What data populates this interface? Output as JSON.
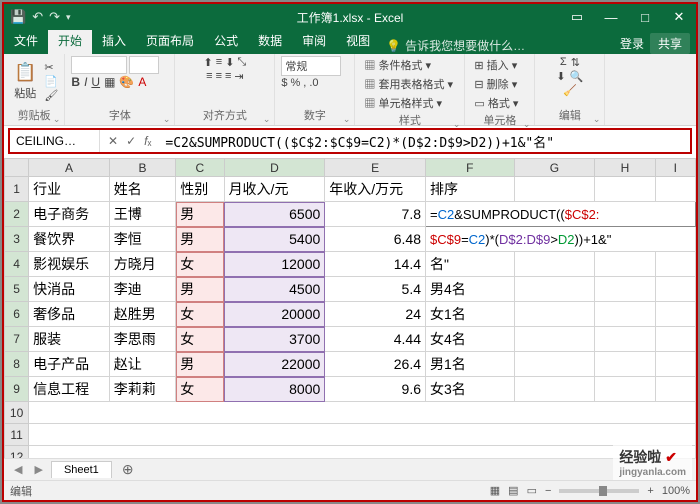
{
  "titlebar": {
    "title": "工作簿1.xlsx - Excel"
  },
  "tabs": {
    "file": "文件",
    "home": "开始",
    "insert": "插入",
    "layout": "页面布局",
    "formulas": "公式",
    "data": "数据",
    "review": "审阅",
    "view": "视图",
    "tell": "告诉我您想要做什么…",
    "login": "登录",
    "share": "共享"
  },
  "ribbon": {
    "clipboard": {
      "paste": "粘贴",
      "label": "剪贴板"
    },
    "font": {
      "label": "字体"
    },
    "align": {
      "wrap": "常规",
      "label": "对齐方式"
    },
    "number": {
      "general": "常规",
      "label": "数字"
    },
    "styles": {
      "cond": "条件格式",
      "table": "套用表格格式",
      "cell": "单元格样式",
      "label": "样式"
    },
    "cells": {
      "insert": "插入",
      "delete": "删除",
      "format": "格式",
      "label": "单元格"
    },
    "editing": {
      "label": "编辑"
    }
  },
  "formula_bar": {
    "name_box": "CEILING…",
    "formula": "=C2&SUMPRODUCT(($C$2:$C$9=C2)*(D$2:D$9>D2))+1&\"名\""
  },
  "columns": [
    "A",
    "B",
    "C",
    "D",
    "E",
    "F",
    "G",
    "H",
    "I"
  ],
  "headers": {
    "A": "行业",
    "B": "姓名",
    "C": "性别",
    "D": "月收入/元",
    "E": "年收入/万元",
    "F": "排序"
  },
  "rows": [
    {
      "A": "电子商务",
      "B": "王博",
      "C": "男",
      "D": "6500",
      "E": "7.8"
    },
    {
      "A": "餐饮界",
      "B": "李恒",
      "C": "男",
      "D": "5400",
      "E": "6.48"
    },
    {
      "A": "影视娱乐",
      "B": "方晓月",
      "C": "女",
      "D": "12000",
      "E": "14.4"
    },
    {
      "A": "快消品",
      "B": "李迪",
      "C": "男",
      "D": "4500",
      "E": "5.4"
    },
    {
      "A": "奢侈品",
      "B": "赵胜男",
      "C": "女",
      "D": "20000",
      "E": "24"
    },
    {
      "A": "服装",
      "B": "李思雨",
      "C": "女",
      "D": "3700",
      "E": "4.44"
    },
    {
      "A": "电子产品",
      "B": "赵让",
      "C": "男",
      "D": "22000",
      "E": "26.4"
    },
    {
      "A": "信息工程",
      "B": "李莉莉",
      "C": "女",
      "D": "8000",
      "E": "9.6"
    }
  ],
  "f_edit": {
    "line1_pre": "=",
    "line1_c2": "C2",
    "line1_mid": "&SUMPRODUCT((",
    "line1_end": "$C$2:",
    "line2_a": "$C$9",
    "line2_eq": "=",
    "line2_b": "C2",
    "line2_star": ")*(",
    "line2_d": "D$2:D$9",
    "line2_gt": ">",
    "line2_d2": "D2",
    "line2_tail": "))+1&\"",
    "line3": "名\""
  },
  "f_results": {
    "r5": "男4名",
    "r6": "女1名",
    "r7": "女4名",
    "r8": "男1名",
    "r9": "女3名"
  },
  "sheet_tab": "Sheet1",
  "status": {
    "mode": "编辑",
    "zoom": "100%"
  },
  "watermark": {
    "brand": "经验啦",
    "url": "jingyanla.com"
  }
}
